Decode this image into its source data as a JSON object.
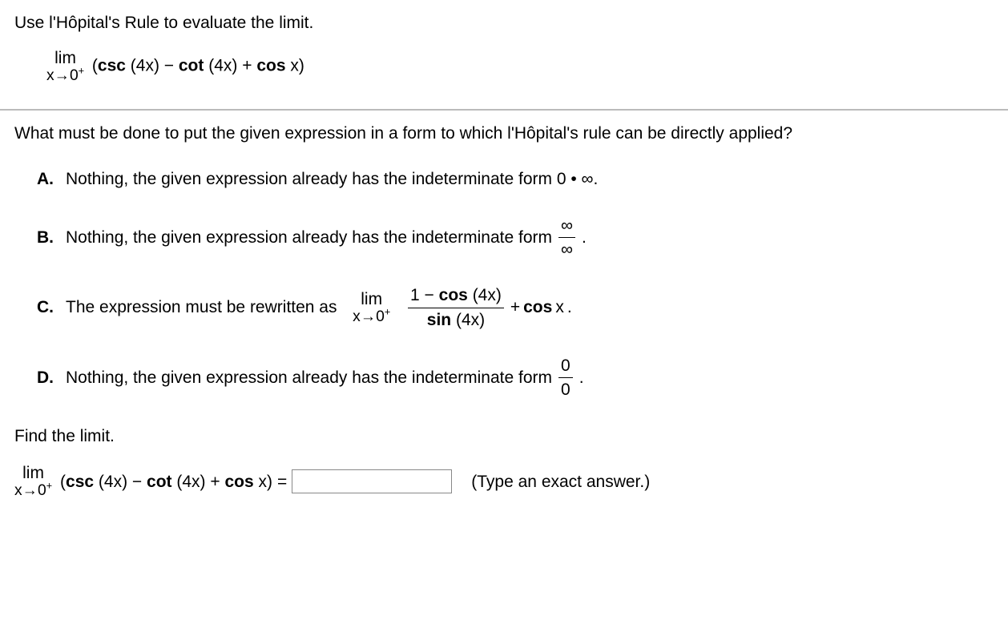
{
  "problem": {
    "instruction": "Use l'Hôpital's Rule to evaluate the limit.",
    "limit_word": "lim",
    "limit_sub_x": "x",
    "limit_sub_arrow": "→",
    "limit_sub_target": "0",
    "limit_sub_sup": "+",
    "expr_open": "(",
    "expr_csc": "csc",
    "expr_csc_arg": " (4x)",
    "expr_minus": " − ",
    "expr_cot": "cot",
    "expr_cot_arg": " (4x)",
    "expr_plus": " + ",
    "expr_cos": "cos",
    "expr_cos_arg": " x",
    "expr_close": ")"
  },
  "question1": "What must be done to put the given expression in a form to which l'Hôpital's rule can be directly applied?",
  "choices": {
    "A": {
      "label": "A.",
      "text": "Nothing, the given expression already has the indeterminate form 0 • ∞."
    },
    "B": {
      "label": "B.",
      "text_prefix": "Nothing, the given expression already has the indeterminate form ",
      "frac_num": "∞",
      "frac_den": "∞",
      "text_suffix": "."
    },
    "C": {
      "label": "C.",
      "text_prefix": "The expression must be rewritten as ",
      "limit_word": "lim",
      "frac_num_pre": "1 − ",
      "frac_num_cos": "cos",
      "frac_num_arg": " (4x)",
      "frac_den_sin": "sin",
      "frac_den_arg": " (4x)",
      "plus": " + ",
      "cos": "cos",
      "cos_arg": " x",
      "text_suffix": "."
    },
    "D": {
      "label": "D.",
      "text_prefix": "Nothing, the given expression already has the indeterminate form ",
      "frac_num": "0",
      "frac_den": "0",
      "text_suffix": "."
    }
  },
  "question2": {
    "prompt": "Find the limit.",
    "eq": " = ",
    "hint": "(Type an exact answer.)"
  }
}
